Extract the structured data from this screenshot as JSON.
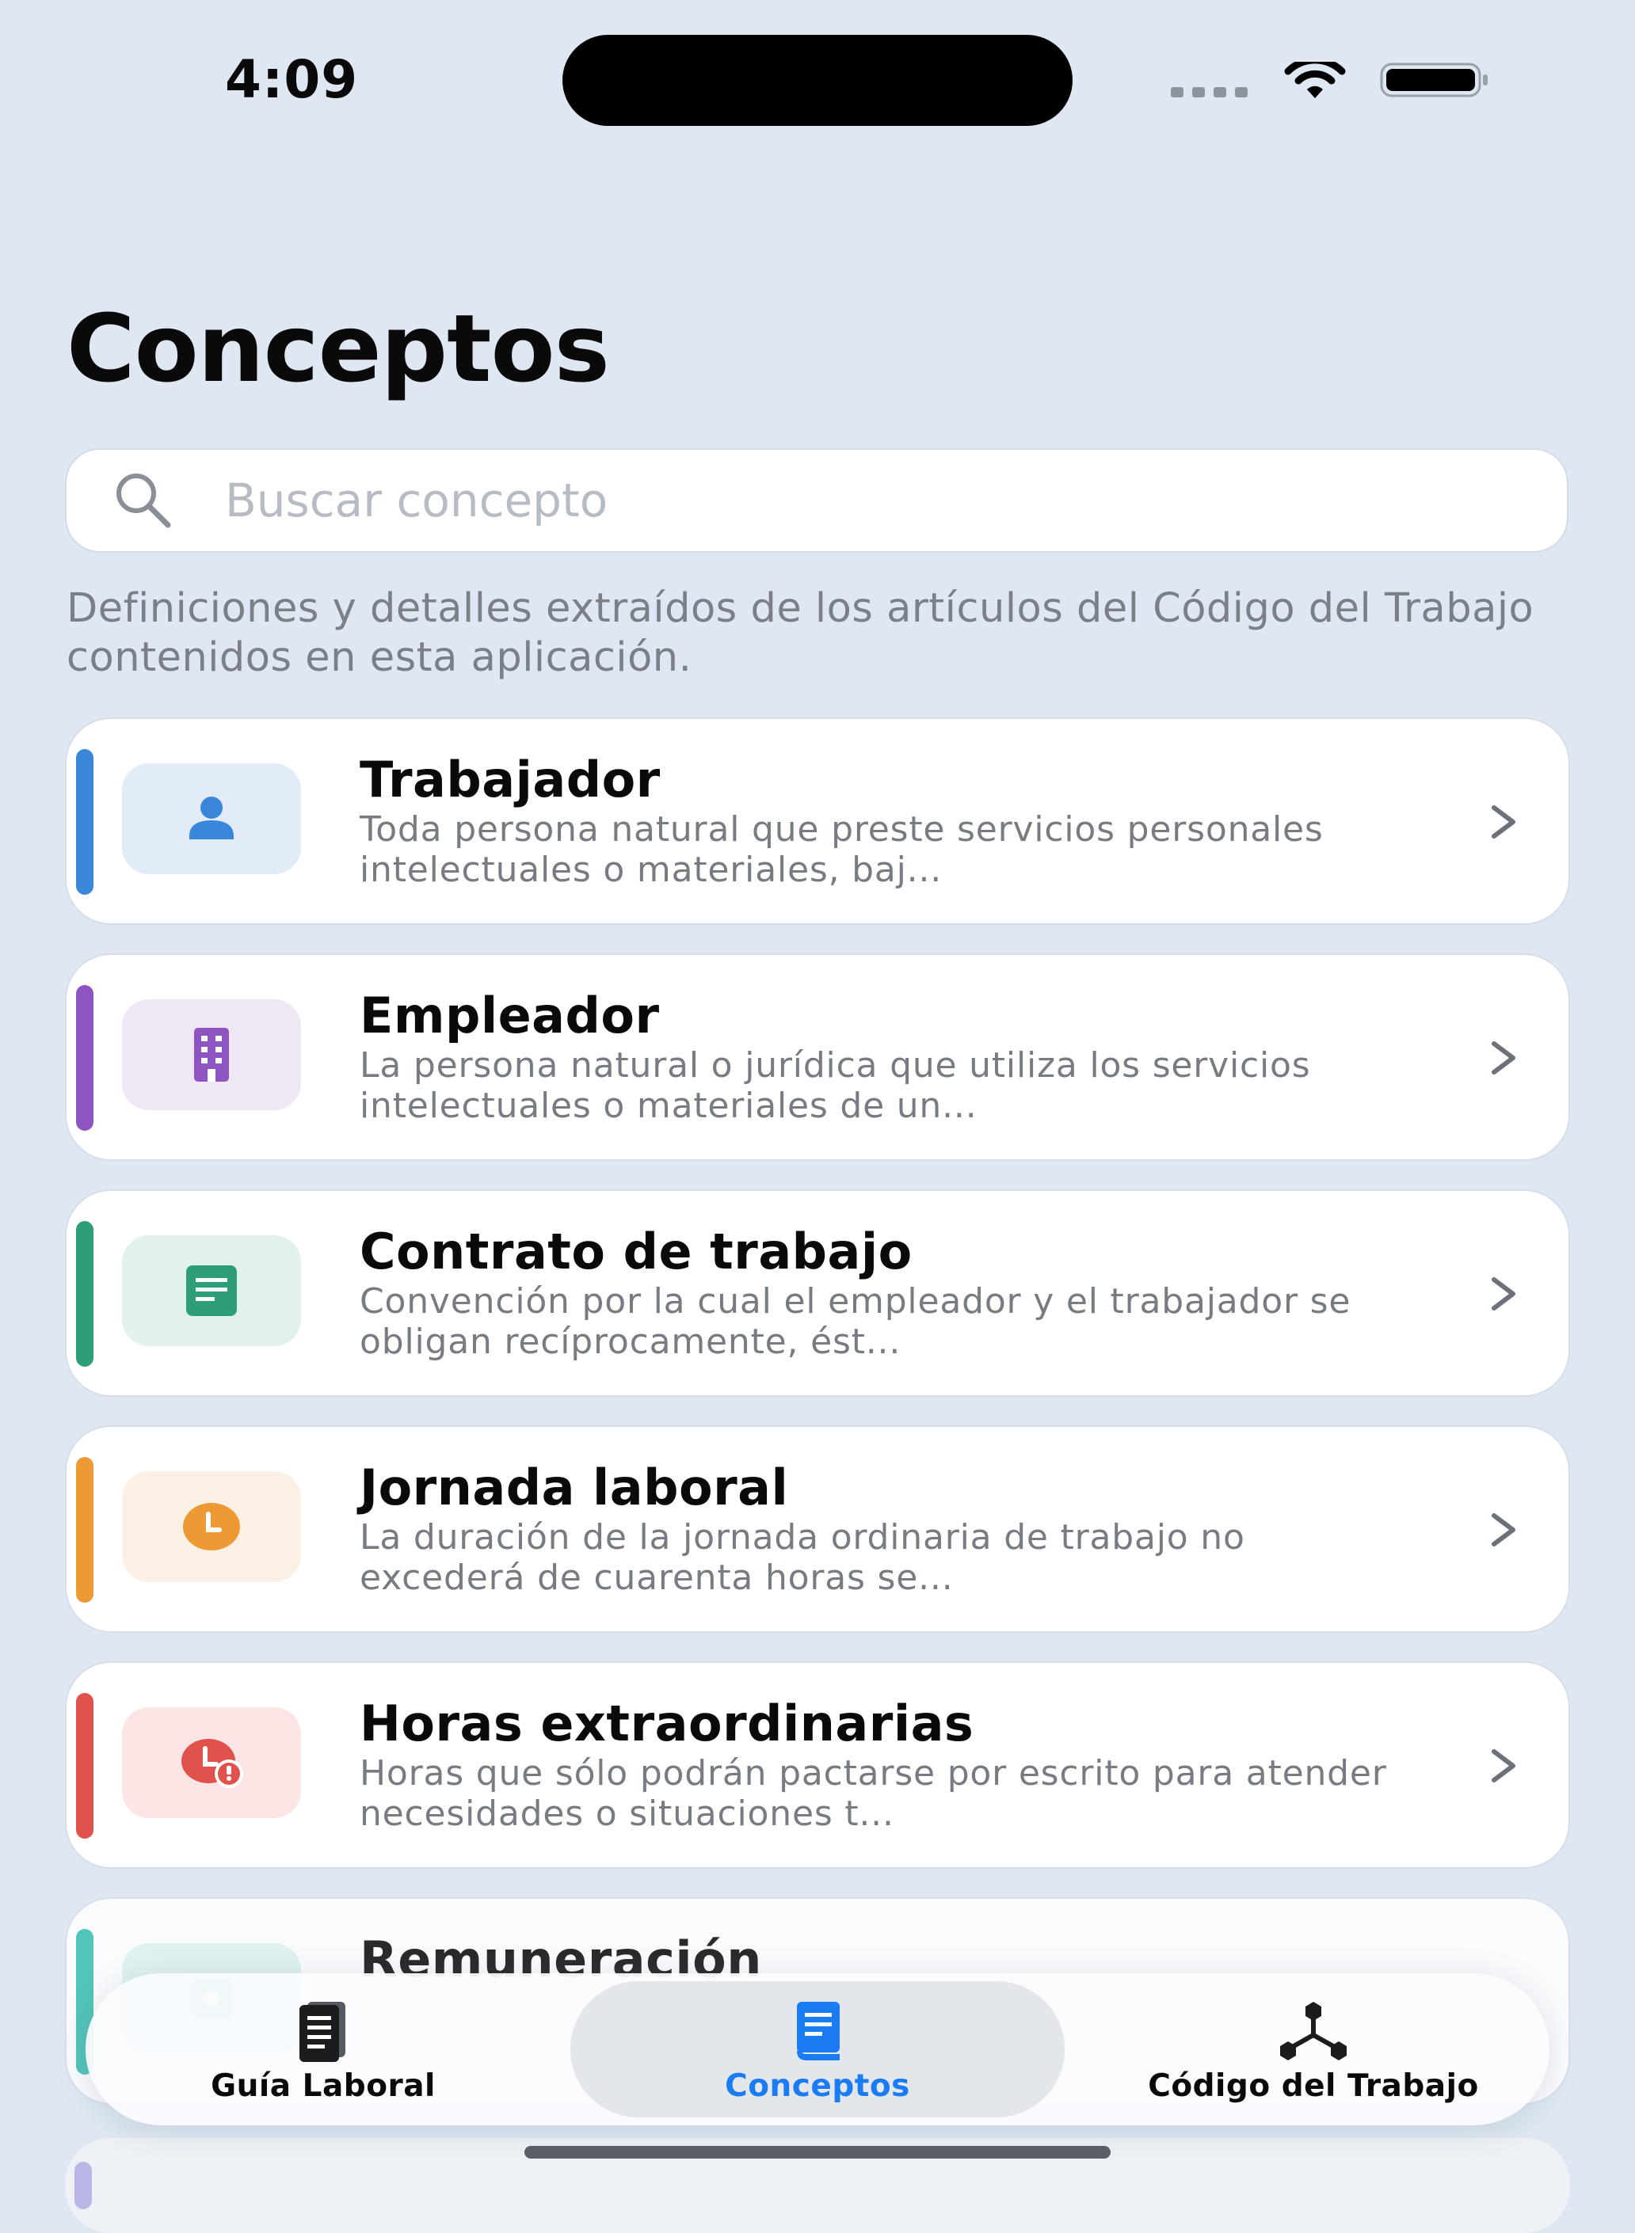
{
  "status_bar": {
    "time": "4:09"
  },
  "page": {
    "title": "Conceptos",
    "intro": "Definiciones y detalles extraídos de los artículos del Código del Trabajo contenidos en esta aplicación."
  },
  "search": {
    "placeholder": "Buscar concepto",
    "value": ""
  },
  "concepts": [
    {
      "title": "Trabajador",
      "summary": "Toda persona natural que preste servicios personales intelectuales o materiales, baj...",
      "icon": "person-icon",
      "accent": "#3a86d8",
      "icon_bg": "#e1ecf8"
    },
    {
      "title": "Empleador",
      "summary": "La persona natural o jurídica que utiliza los servicios intelectuales o materiales de un...",
      "icon": "building-icon",
      "accent": "#8e55c2",
      "icon_bg": "#efe7f4"
    },
    {
      "title": "Contrato de trabajo",
      "summary": "Convención por la cual el empleador y el trabajador se obligan recíprocamente, ést...",
      "icon": "document-icon",
      "accent": "#2e9e78",
      "icon_bg": "#e2f1ec"
    },
    {
      "title": "Jornada laboral",
      "summary": "La duración de la jornada ordinaria de trabajo no excederá de cuarenta horas se...",
      "icon": "clock-icon",
      "accent": "#ee9a34",
      "icon_bg": "#fbf0e4"
    },
    {
      "title": "Horas extraordinarias",
      "summary": "Horas que sólo podrán pactarse por escrito para atender necesidades o situaciones t...",
      "icon": "clock-alert-icon",
      "accent": "#e0524b",
      "icon_bg": "#fbe6e5"
    },
    {
      "title": "Remuneración",
      "summary": "",
      "icon": "money-icon",
      "accent": "#3bbfae",
      "icon_bg": "#e0f4f1"
    }
  ],
  "tab_bar": {
    "tabs": [
      {
        "label": "Guía Laboral",
        "icon": "book-icon",
        "active": false
      },
      {
        "label": "Conceptos",
        "icon": "text-book-icon",
        "active": true
      },
      {
        "label": "Código del Trabajo",
        "icon": "network-icon",
        "active": false
      }
    ],
    "active_color": "#1a7cf2"
  }
}
